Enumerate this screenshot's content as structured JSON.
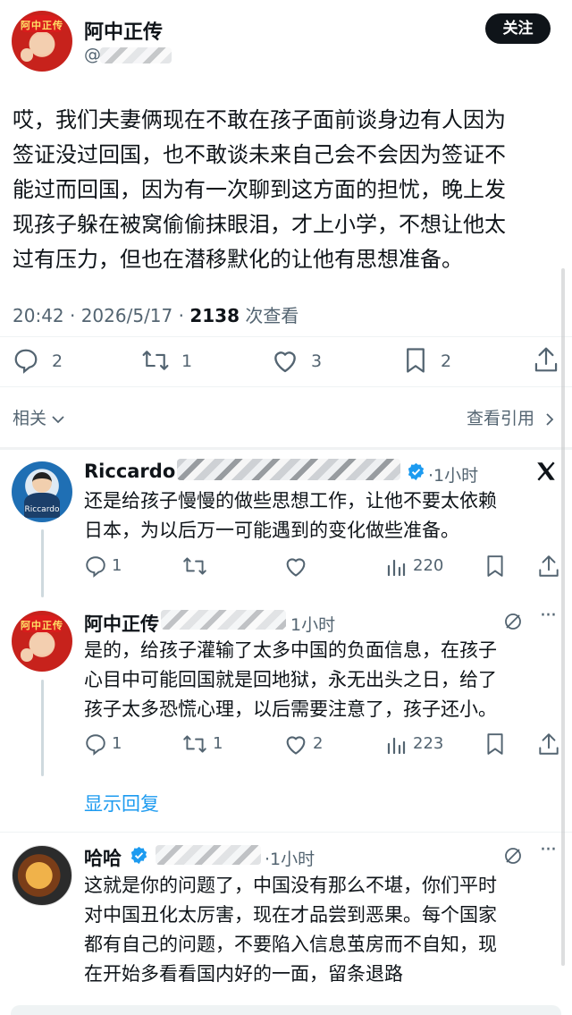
{
  "main_post": {
    "author_name": "阿中正传",
    "author_handle": "@",
    "follow_label": "关注",
    "text_lines": [
      "哎，我们夫妻俩现在不敢在孩子面前谈身边有人因为",
      "签证没过回国，也不敢谈未来自己会不会因为签证不",
      "能过而回国，因为有一次聊到这方面的担忧，晚上发",
      "现孩子躲在被窝偷偷抹眼泪，才上小学，不想让他太",
      "过有压力，但也在潜移默化的让他有思想准备。"
    ],
    "time": "20:42 · 2026/5/17 · ",
    "views_count": "2138",
    "views_label": " 次查看",
    "replies": "2",
    "reposts": "1",
    "likes": "3",
    "bookmarks": "2"
  },
  "related": {
    "left_label": "相关",
    "right_label": "查看引用"
  },
  "replies": [
    {
      "author": "Riccardo",
      "time": "·1小时",
      "text_lines": [
        "还是给孩子慢慢的做些思想工作，让他不要太依赖",
        "日本，为以后万一可能遇到的变化做些准备。"
      ],
      "replies": "1",
      "reposts": "",
      "likes": "",
      "views": "220",
      "avatar_label": "Riccardo"
    },
    {
      "author": "阿中正传",
      "time": "1小时",
      "text_lines": [
        "是的，给孩子灌输了太多中国的负面信息，在孩子",
        "心目中可能回国就是回地狱，永无出头之日，给了",
        "孩子太多恐慌心理，以后需要注意了，孩子还小。"
      ],
      "replies": "1",
      "reposts": "1",
      "likes": "2",
      "views": "223"
    },
    {
      "author": "哈哈",
      "time": "·1小时",
      "text_lines": [
        "这就是你的问题了，中国没有那么不堪，你们平时",
        "对中国丑化太厉害，现在才品尝到恶果。每个国家",
        "都有自己的问题，不要陷入信息茧房而不自知，现",
        "在开始多看看国内好的一面，留条退路"
      ]
    }
  ],
  "show_replies_label": "显示回复",
  "avatar_text": "阿中正传",
  "colors": {
    "text": "#0f1419",
    "secondary": "#536471",
    "link": "#1d9bf0",
    "verified": "#1d9bf0"
  },
  "icons": [
    "reply-icon",
    "repost-icon",
    "like-icon",
    "bookmark-icon",
    "share-icon",
    "views-icon",
    "grok-icon",
    "x-logo-icon",
    "verified-icon",
    "chevron-down-icon",
    "chevron-right-icon"
  ]
}
